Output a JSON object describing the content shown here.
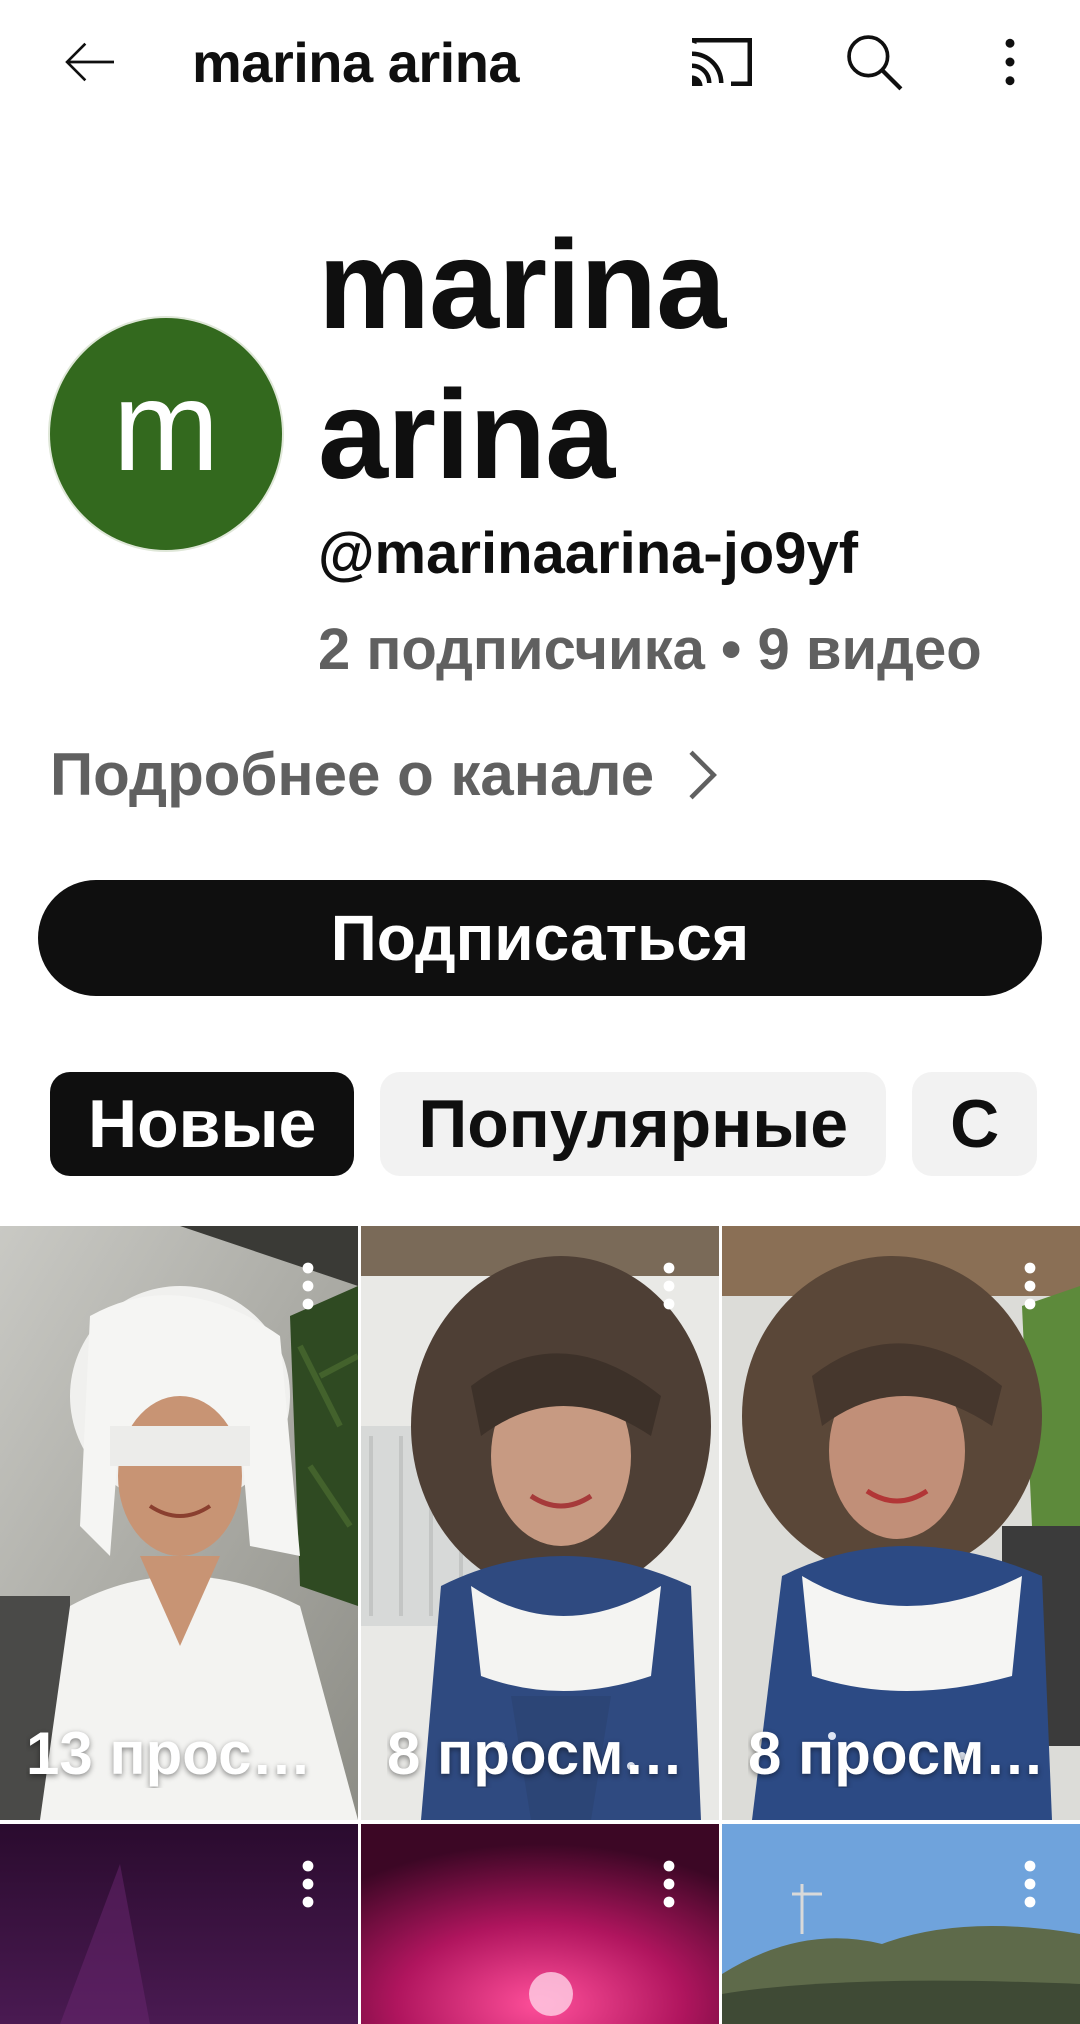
{
  "topbar": {
    "title": "marina arina",
    "back_icon": "arrow-back-icon",
    "cast_icon": "cast-icon",
    "search_icon": "search-icon",
    "more_icon": "more-vert-icon"
  },
  "channel": {
    "avatar_letter": "m",
    "avatar_color": "#33691e",
    "name": "marina arina",
    "handle": "@marinaarina-jo9yf",
    "stats": "2 подписчика • 9 видео",
    "more_about": "Подробнее о канале"
  },
  "subscribe_label": "Подписаться",
  "chips": [
    {
      "label": "Новые",
      "active": true
    },
    {
      "label": "Популярные",
      "active": false
    },
    {
      "label": "С",
      "active": false
    }
  ],
  "shorts": [
    {
      "views": "13 прос…"
    },
    {
      "views": "8 просм…"
    },
    {
      "views": "8 просм…"
    },
    {
      "views": ""
    },
    {
      "views": ""
    },
    {
      "views": ""
    }
  ]
}
